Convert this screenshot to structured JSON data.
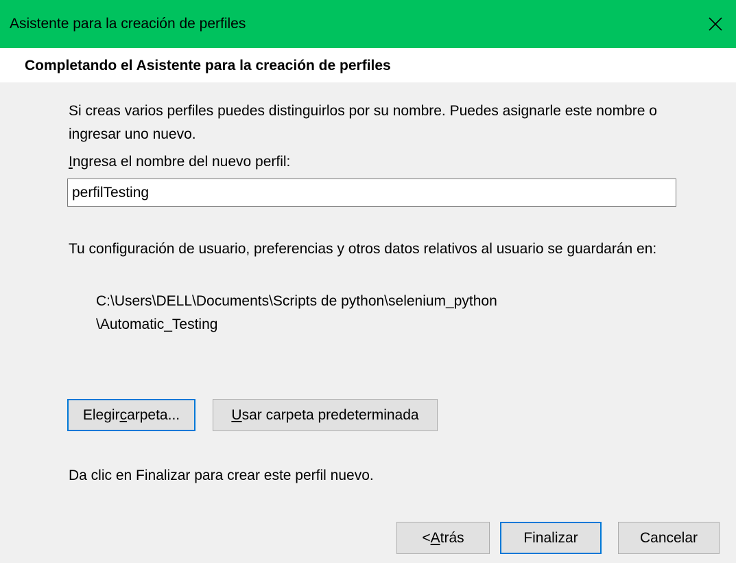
{
  "window": {
    "title": "Asistente para la creación de perfiles",
    "close_glyph": "✕"
  },
  "header": {
    "title": "Completando el Asistente para la creación de perfiles"
  },
  "main": {
    "description": "Si creas varios perfiles puedes distinguirlos por su nombre. Puedes asignarle este nombre o ingresar uno nuevo.",
    "name_label_mnemonic": "I",
    "name_label_rest": "ngresa el nombre del nuevo perfil:",
    "name_value": "perfilTesting",
    "save_description": "Tu configuración de usuario, preferencias y otros datos relativos al usuario se guardarán en:",
    "path_line1": "C:\\Users\\DELL\\Documents\\Scripts de python\\selenium_python",
    "path_line2": "\\Automatic_Testing",
    "choose_folder_before": "Elegir ",
    "choose_folder_mnemonic": "c",
    "choose_folder_after": "arpeta...",
    "default_folder_mnemonic": "U",
    "default_folder_rest": "sar carpeta predeterminada",
    "finish_hint": "Da clic en Finalizar para crear este perfil nuevo."
  },
  "footer": {
    "back_before": "< ",
    "back_mnemonic": "A",
    "back_after": "trás",
    "finish_label": "Finalizar",
    "cancel_label": "Cancelar"
  },
  "colors": {
    "titlebar": "#00c25e",
    "focus": "#0078d7"
  }
}
